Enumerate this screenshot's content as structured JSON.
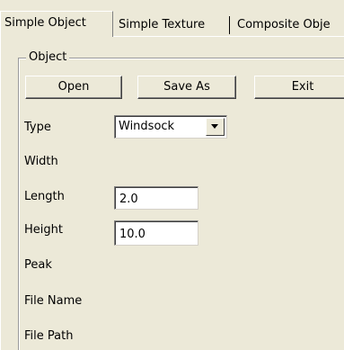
{
  "tabs": [
    {
      "label": "Simple Object",
      "active": true
    },
    {
      "label": "Simple Texture",
      "active": false
    },
    {
      "label": "Composite Obje",
      "active": false
    }
  ],
  "group": {
    "title": "Object"
  },
  "buttons": {
    "open": "Open",
    "save_as": "Save As",
    "exit": "Exit"
  },
  "fields": {
    "type_label": "Type",
    "type_value": "Windsock",
    "width_label": "Width",
    "length_label": "Length",
    "length_value": "2.0",
    "height_label": "Height",
    "height_value": "10.0",
    "peak_label": "Peak",
    "file_name_label": "File Name",
    "file_path_label": "File Path"
  }
}
